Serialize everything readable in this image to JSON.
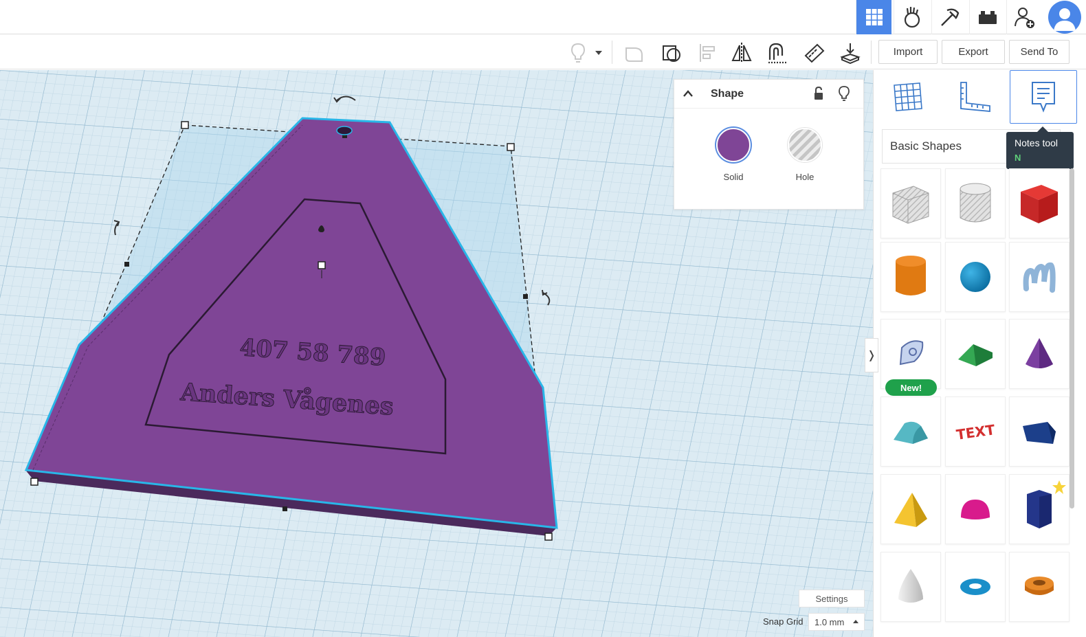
{
  "topbar": {
    "icons": [
      "grid-view-icon",
      "learn-hand-icon",
      "pickaxe-icon",
      "bricks-icon",
      "add-user-icon"
    ],
    "active_icon": "grid-view-icon"
  },
  "toolbar": {
    "tools": [
      "lightbulb-icon",
      "dropdown-caret-icon",
      "group-icon",
      "workplane-shape-icon",
      "align-icon",
      "mirror-icon",
      "cruise-icon",
      "ruler-icon",
      "drop-icon"
    ],
    "import_label": "Import",
    "export_label": "Export",
    "sendto_label": "Send To"
  },
  "workplane": {
    "text_line1": "407 58 789",
    "text_line2": "Anders Vågenes",
    "shape_color": "#7f4596",
    "selection_color": "#29b6e8"
  },
  "shape_panel": {
    "title": "Shape",
    "solid_label": "Solid",
    "hole_label": "Hole",
    "solid_color": "#7f4596"
  },
  "right_panel": {
    "tabs": [
      "workplane-tool-icon",
      "ruler-tool-icon",
      "notes-tool-icon"
    ],
    "active_tab": "notes-tool-icon",
    "library": "Basic Shapes",
    "tooltip_title": "Notes tool",
    "tooltip_key": "N",
    "new_badge": "New!",
    "shapes": [
      "box-hole",
      "cylinder-hole",
      "box",
      "cylinder",
      "sphere",
      "scribble",
      "sketch",
      "roof",
      "cone",
      "round-roof",
      "text",
      "wedge",
      "pyramid",
      "half-sphere",
      "polygon",
      "paraboloid",
      "torus",
      "tube"
    ]
  },
  "footer": {
    "settings_label": "Settings",
    "snap_grid_label": "Snap Grid",
    "snap_grid_value": "1.0 mm"
  }
}
